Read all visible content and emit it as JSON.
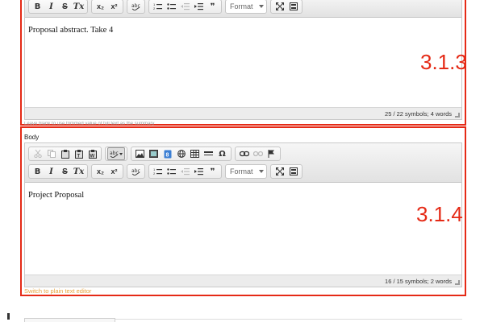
{
  "editors": [
    {
      "content": "Proposal abstract. Take 4",
      "status": "25 / 22 symbols; 4 words",
      "section_number": "3.1.3"
    },
    {
      "label": "Body",
      "content": "Project Proposal",
      "status": "16 / 15 symbols; 2 words",
      "section_number": "3.1.4"
    }
  ],
  "format_label": "Format",
  "hint_text": "Leave blank to use trimmed value of full text as the summary",
  "switch_link": "Switch to plain text editor",
  "toolbar_labels": {
    "bold": "B",
    "italic": "I",
    "strike": "S",
    "remove_format": "Tx",
    "subscript": "x₂",
    "superscript": "x²",
    "omega": "Ω",
    "quote": "❞"
  },
  "colors": {
    "highlight": "#e52a16",
    "link": "#e8a33d"
  }
}
